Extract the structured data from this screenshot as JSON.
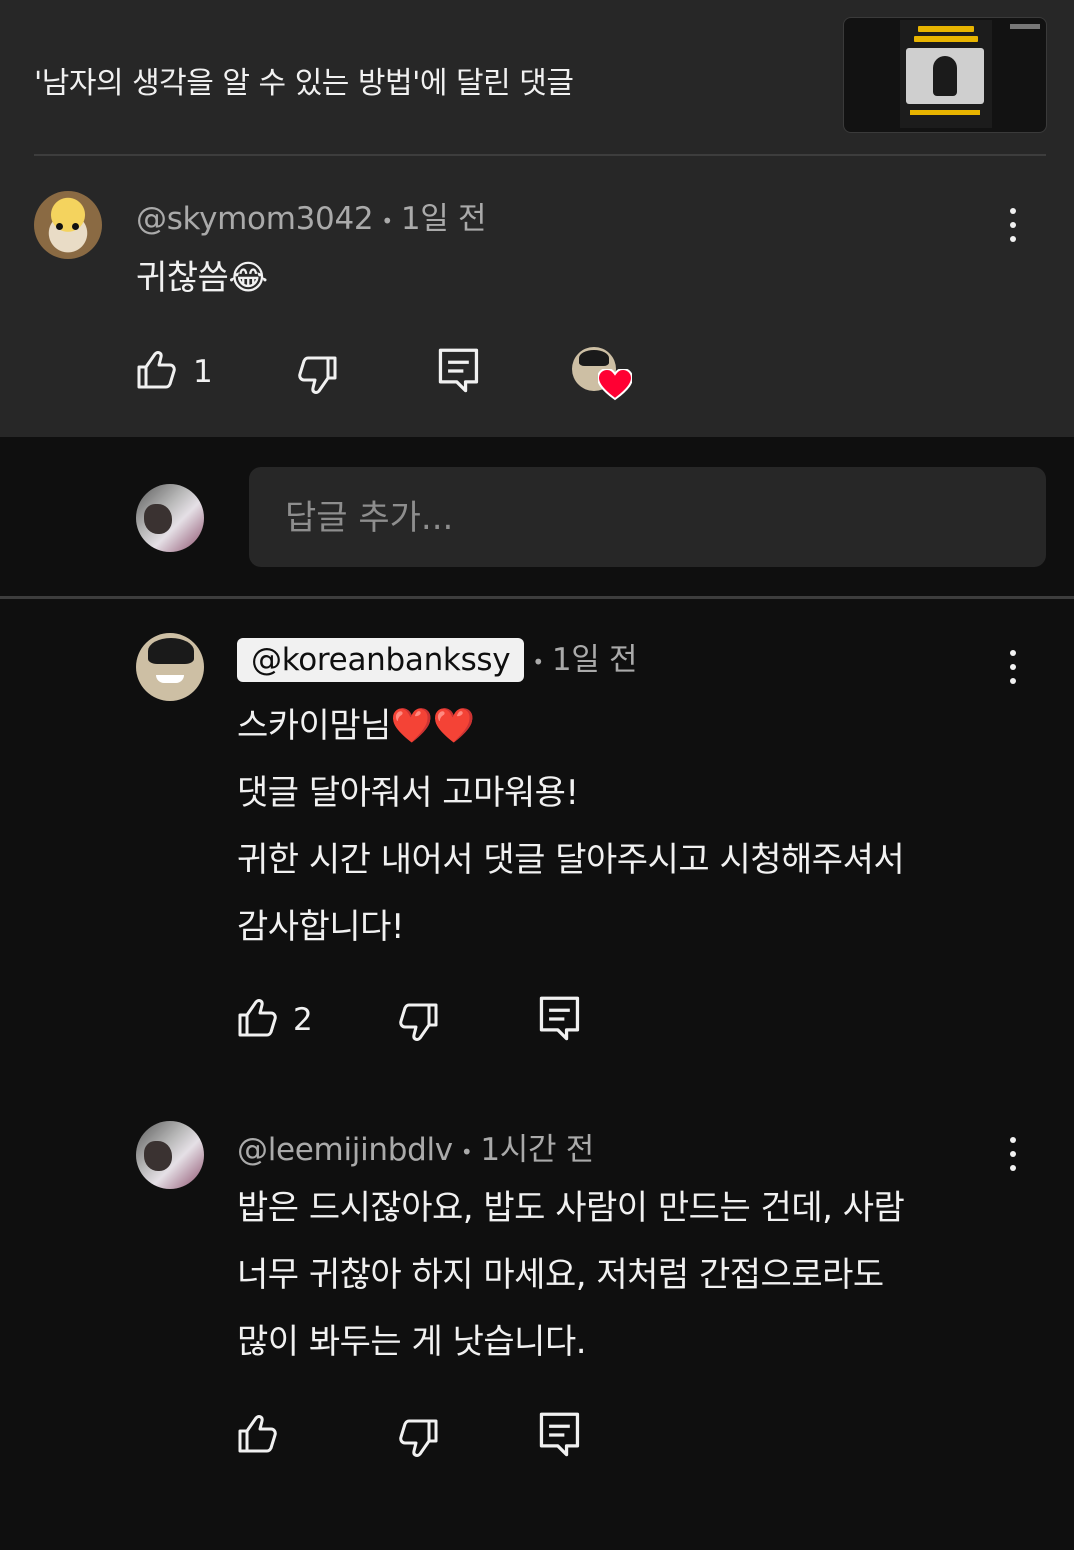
{
  "video": {
    "title": "'남자의 생각을 알 수 있는 방법'에 달린 댓글"
  },
  "comment": {
    "handle": "@skymom3042",
    "time": "1일 전",
    "text": "귀찮씀😂",
    "likes": "1"
  },
  "reply_input": {
    "placeholder": "답글 추가..."
  },
  "replies": [
    {
      "handle": "@koreanbankssy",
      "time": "1일 전",
      "lines": [
        "스카이맘님❤️❤️",
        "댓글 달아줘서 고마워용!",
        "귀한 시간 내어서 댓글 달아주시고 시청해주셔서",
        "감사합니다!"
      ],
      "likes": "2"
    },
    {
      "handle": "@leemijinbdlv",
      "time": "1시간 전",
      "lines": [
        "밥은 드시잖아요, 밥도 사람이 만드는 건데, 사람",
        "너무 귀찮아 하지 마세요, 저처럼 간접으로라도",
        "많이 봐두는 게 낫습니다."
      ],
      "likes": ""
    }
  ],
  "icons": {
    "like": "thumbs-up-icon",
    "dislike": "thumbs-down-icon",
    "reply": "reply-icon",
    "more": "more-vert-icon",
    "heart": "creator-heart-icon"
  },
  "colors": {
    "background": "#0f0f0f",
    "surface": "#272727",
    "muted_text": "#aaaaaa",
    "heart": "#ff0033"
  }
}
